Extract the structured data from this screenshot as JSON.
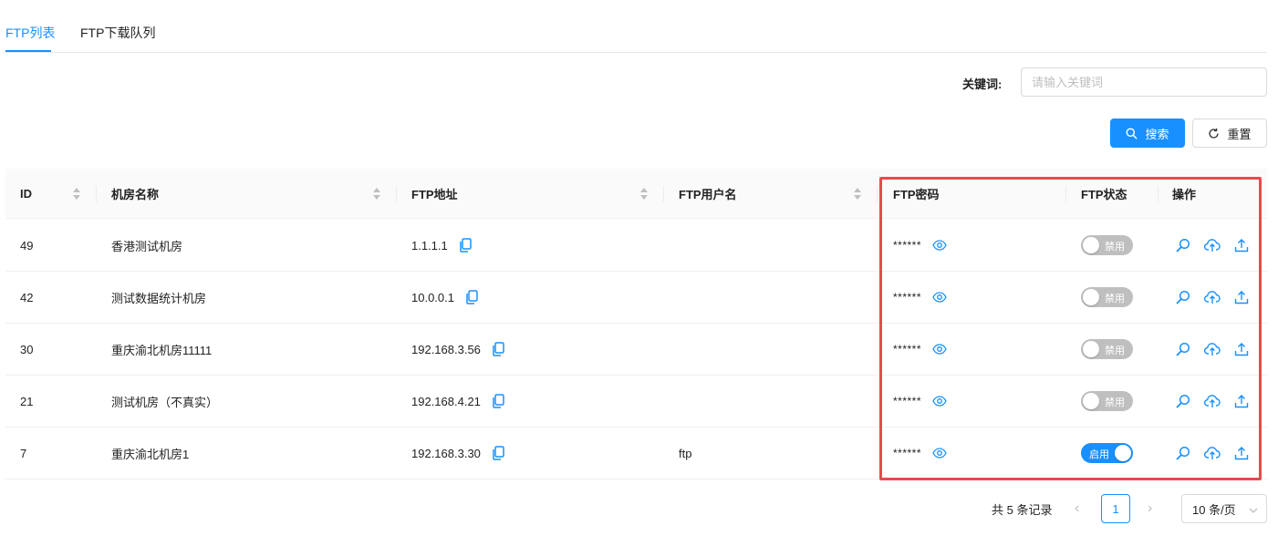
{
  "tabs": [
    {
      "label": "FTP列表",
      "active": true
    },
    {
      "label": "FTP下载队列",
      "active": false
    }
  ],
  "search": {
    "keyword_label": "关键词:",
    "placeholder": "请输入关键词",
    "value": "",
    "search_label": "搜索",
    "reset_label": "重置"
  },
  "table": {
    "columns": [
      "ID",
      "机房名称",
      "FTP地址",
      "FTP用户名",
      "FTP密码",
      "FTP状态",
      "操作"
    ],
    "rows": [
      {
        "id": "49",
        "room": "香港测试机房",
        "address": "1.1.1.1",
        "username": "",
        "password": "******",
        "status": "禁用",
        "enabled": false
      },
      {
        "id": "42",
        "room": "测试数据统计机房",
        "address": "10.0.0.1",
        "username": "",
        "password": "******",
        "status": "禁用",
        "enabled": false
      },
      {
        "id": "30",
        "room": "重庆渝北机房11111",
        "address": "192.168.3.56",
        "username": "",
        "password": "******",
        "status": "禁用",
        "enabled": false
      },
      {
        "id": "21",
        "room": "测试机房（不真实）",
        "address": "192.168.4.21",
        "username": "",
        "password": "******",
        "status": "禁用",
        "enabled": false
      },
      {
        "id": "7",
        "room": "重庆渝北机房1",
        "address": "192.168.3.30",
        "username": "ftp",
        "password": "******",
        "status": "启用",
        "enabled": true
      }
    ]
  },
  "pagination": {
    "total_label": "共 5 条记录",
    "prev": "‹",
    "next": "›",
    "current_page": "1",
    "page_size_label": "10 条/页"
  },
  "colors": {
    "primary": "#1890ff",
    "highlight_border": "#e84a4f",
    "switch_off": "#bfbfbf"
  },
  "icons": [
    "search-icon",
    "reload-icon",
    "copy-icon",
    "eye-icon",
    "zoom-icon",
    "cloud-upload-icon",
    "upload-icon",
    "chevron-down-icon",
    "sort-icon"
  ]
}
